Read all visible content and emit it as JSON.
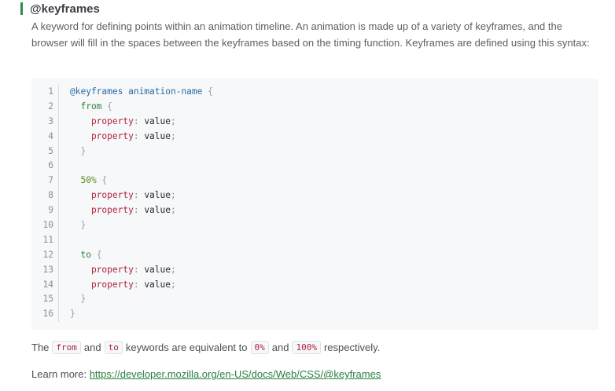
{
  "heading": "@keyframes",
  "description": "A keyword for defining points within an animation timeline. An animation is made up of a variety of keyframes, and the browser will fill in the spaces between the keyframes based on the timing function. Keyframes are defined using this syntax:",
  "code_lines": [
    {
      "n": "1",
      "tokens": [
        {
          "t": "@keyframes",
          "c": "c-name"
        },
        {
          "t": " animation-name ",
          "c": "c-name"
        },
        {
          "t": "{",
          "c": "c-brace"
        }
      ]
    },
    {
      "n": "2",
      "tokens": [
        {
          "t": "  from ",
          "c": "c-kw"
        },
        {
          "t": "{",
          "c": "c-brace"
        }
      ]
    },
    {
      "n": "3",
      "tokens": [
        {
          "t": "    property",
          "c": "c-prop"
        },
        {
          "t": ": ",
          "c": "c-punct"
        },
        {
          "t": "value",
          "c": "c-val"
        },
        {
          "t": ";",
          "c": "c-punct"
        }
      ]
    },
    {
      "n": "4",
      "tokens": [
        {
          "t": "    property",
          "c": "c-prop"
        },
        {
          "t": ": ",
          "c": "c-punct"
        },
        {
          "t": "value",
          "c": "c-val"
        },
        {
          "t": ";",
          "c": "c-punct"
        }
      ]
    },
    {
      "n": "5",
      "tokens": [
        {
          "t": "  }",
          "c": "c-brace"
        }
      ]
    },
    {
      "n": "6",
      "tokens": []
    },
    {
      "n": "7",
      "tokens": [
        {
          "t": "  50% ",
          "c": "c-pct"
        },
        {
          "t": "{",
          "c": "c-brace"
        }
      ]
    },
    {
      "n": "8",
      "tokens": [
        {
          "t": "    property",
          "c": "c-prop"
        },
        {
          "t": ": ",
          "c": "c-punct"
        },
        {
          "t": "value",
          "c": "c-val"
        },
        {
          "t": ";",
          "c": "c-punct"
        }
      ]
    },
    {
      "n": "9",
      "tokens": [
        {
          "t": "    property",
          "c": "c-prop"
        },
        {
          "t": ": ",
          "c": "c-punct"
        },
        {
          "t": "value",
          "c": "c-val"
        },
        {
          "t": ";",
          "c": "c-punct"
        }
      ]
    },
    {
      "n": "10",
      "tokens": [
        {
          "t": "  }",
          "c": "c-brace"
        }
      ]
    },
    {
      "n": "11",
      "tokens": []
    },
    {
      "n": "12",
      "tokens": [
        {
          "t": "  to ",
          "c": "c-kw"
        },
        {
          "t": "{",
          "c": "c-brace"
        }
      ]
    },
    {
      "n": "13",
      "tokens": [
        {
          "t": "    property",
          "c": "c-prop"
        },
        {
          "t": ": ",
          "c": "c-punct"
        },
        {
          "t": "value",
          "c": "c-val"
        },
        {
          "t": ";",
          "c": "c-punct"
        }
      ]
    },
    {
      "n": "14",
      "tokens": [
        {
          "t": "    property",
          "c": "c-prop"
        },
        {
          "t": ": ",
          "c": "c-punct"
        },
        {
          "t": "value",
          "c": "c-val"
        },
        {
          "t": ";",
          "c": "c-punct"
        }
      ]
    },
    {
      "n": "15",
      "tokens": [
        {
          "t": "  }",
          "c": "c-brace"
        }
      ]
    },
    {
      "n": "16",
      "tokens": [
        {
          "t": "}",
          "c": "c-brace"
        }
      ]
    }
  ],
  "equivalence": {
    "the": "The",
    "from": "from",
    "and1": "and",
    "to": "to",
    "mid": "keywords are equivalent to",
    "zero": "0%",
    "and2": "and",
    "hundred": "100%",
    "end": "respectively."
  },
  "learn_more": {
    "label": "Learn more: ",
    "link_text": "https://developer.mozilla.org/en-US/docs/Web/CSS/@keyframes"
  },
  "colors": {
    "accent": "#2f8a4a",
    "link": "#2a7f3e",
    "code_bg": "#f6f8fa",
    "property": "#b0243a"
  }
}
